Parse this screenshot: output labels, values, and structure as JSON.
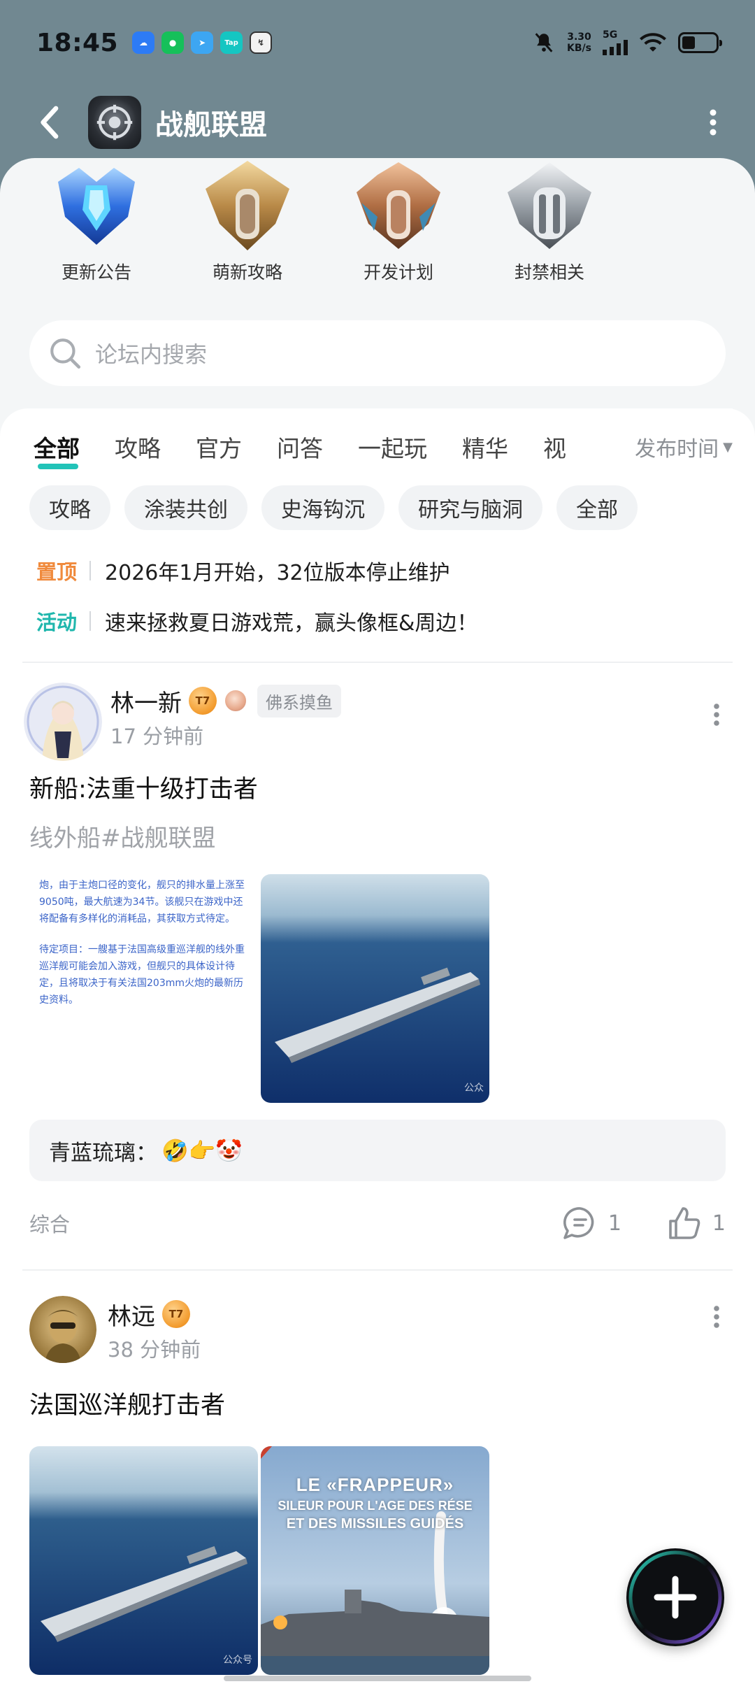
{
  "status_bar": {
    "time": "18:45",
    "net_speed_value": "3.30",
    "net_speed_unit": "KB/s",
    "net_type": "5G"
  },
  "header": {
    "title": "战舰联盟"
  },
  "shortcuts": [
    {
      "label": "更新公告"
    },
    {
      "label": "萌新攻略"
    },
    {
      "label": "开发计划"
    },
    {
      "label": "封禁相关"
    }
  ],
  "search": {
    "placeholder": "论坛内搜索"
  },
  "tabs": [
    "全部",
    "攻略",
    "官方",
    "问答",
    "一起玩",
    "精华",
    "视"
  ],
  "active_tab": "全部",
  "sort_label": "发布时间",
  "chips": [
    "攻略",
    "涂装共创",
    "史海钩沉",
    "研究与脑洞",
    "全部"
  ],
  "pinned": [
    {
      "tag": "置顶",
      "tag_color": "#f08a3c",
      "text": "2026年1月开始，32位版本停止维护"
    },
    {
      "tag": "活动",
      "tag_color": "#20b7ad",
      "text": "速来拯救夏日游戏荒，赢头像框&周边！"
    }
  ],
  "posts": [
    {
      "author": "林一新",
      "level": "7",
      "title_tag": "佛系摸鱼",
      "time": "17 分钟前",
      "title": "新船:法重十级打击者",
      "subtitle": "线外船#战舰联盟",
      "image_text_1": "炮，由于主炮口径的变化，舰只的排水量上涨至9050吨，最大航速为34节。该舰只在游戏中还将配备有多样化的消耗品，其获取方式待定。",
      "image_text_2": "待定项目：一艘基于法国高级重巡洋舰的线外重巡洋舰可能会加入游戏，但舰只的具体设计待定，且将取决于有关法国203mm火炮的最新历史资料。",
      "watermark": "公众",
      "comment_author": "青蓝琉璃：",
      "comment_emoji": "🤣👉🤡",
      "category": "综合",
      "comments": "1",
      "likes": "1"
    },
    {
      "author": "林远",
      "level": "7",
      "time": "38 分钟前",
      "title": "法国巡洋舰打击者",
      "watermark": "公众号",
      "image_caption_1": "LE «FRAPPEUR»",
      "image_caption_2": "SILEUR POUR L'AGE DES RÉSE",
      "image_caption_3": "ET DES MISSILES GUIDÉS"
    }
  ],
  "colors": {
    "accent": "#22c3b8",
    "header_bg": "#718891",
    "sheet_bg": "#f4f6f7"
  }
}
